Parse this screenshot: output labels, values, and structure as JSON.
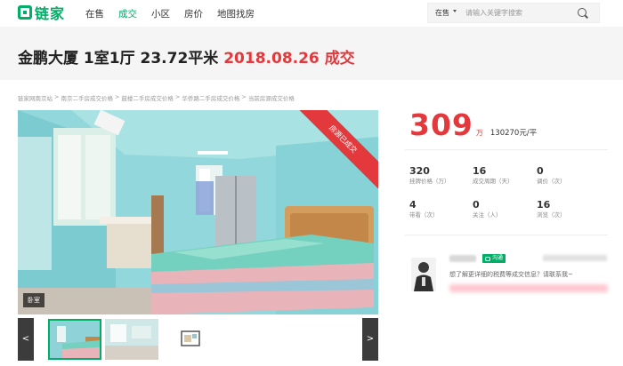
{
  "nav": {
    "logo": "链家",
    "links": [
      "在售",
      "成交",
      "小区",
      "房价",
      "地图找房"
    ],
    "active_index": 1,
    "search_scope": "在售",
    "search_placeholder": "请输入关键字搜索"
  },
  "listing": {
    "name": "金鹏大厦",
    "layout": "1室1厅",
    "area": "23.72平米",
    "deal_date": "2018.08.26",
    "deal_label": "成交"
  },
  "breadcrumb": [
    "链家网南京站",
    "南京二手房成交价格",
    "鼓楼二手房成交价格",
    "华侨路二手房成交价格",
    "当前房源成交价格"
  ],
  "photo": {
    "ribbon": "房源已成交",
    "room_tag": "卧室"
  },
  "thumbnails": {
    "prev": "<",
    "next": ">",
    "count": 3
  },
  "price": {
    "total": "309",
    "unit": "万",
    "unit_price": "130270元/平"
  },
  "stats": [
    {
      "value": "320",
      "label": "挂牌价格（万）"
    },
    {
      "value": "16",
      "label": "成交周期（天）"
    },
    {
      "value": "0",
      "label": "调价（次）"
    },
    {
      "value": "4",
      "label": "带看（次）"
    },
    {
      "value": "0",
      "label": "关注（人）"
    },
    {
      "value": "16",
      "label": "浏览（次）"
    }
  ],
  "agent": {
    "chat_label": "沟通",
    "message": "想了解更详细的税费等成交信息？请联系我~"
  },
  "colors": {
    "brand": "#00ae66",
    "accent": "#e4393c"
  }
}
